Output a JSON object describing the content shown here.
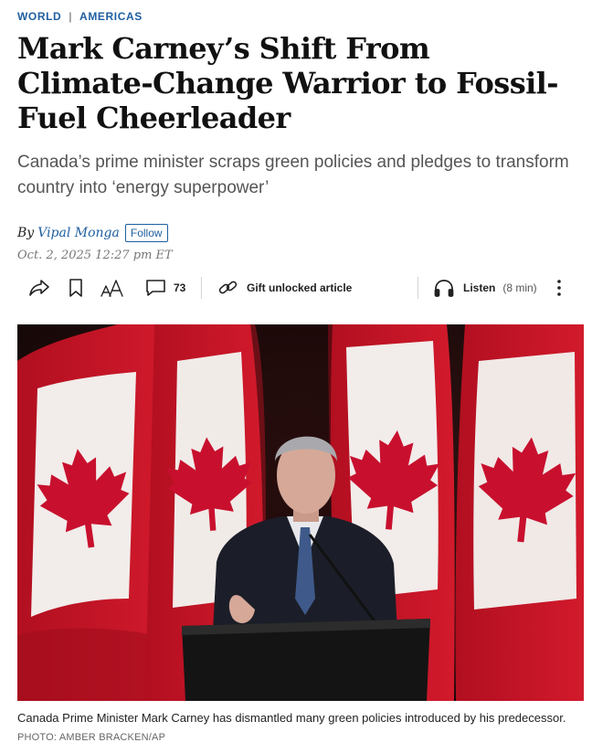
{
  "breadcrumb": {
    "section": "WORLD",
    "subsection": "AMERICAS"
  },
  "headline": "Mark Carney’s Shift From Climate-Change Warrior to Fossil-Fuel Cheerleader",
  "dek": "Canada’s prime minister scraps green policies and pledges to transform country into ‘energy superpower’",
  "byline": {
    "prefix": "By",
    "author": "Vipal Monga",
    "follow_label": "Follow"
  },
  "timestamp": "Oct. 2, 2025 12:27 pm ET",
  "toolbar": {
    "share_icon": "share-icon",
    "bookmark_icon": "bookmark-icon",
    "text_size_icon": "text-size-icon",
    "comments_icon": "comment-icon",
    "comment_count": "73",
    "gift_icon": "link-icon",
    "gift_label": "Gift unlocked article",
    "listen_icon": "headphones-icon",
    "listen_label": "Listen",
    "listen_duration": "(8 min)",
    "more_icon": "more-vertical-icon"
  },
  "photo": {
    "subject": "man speaking at a podium in front of Canadian flags"
  },
  "caption": {
    "text": "Canada Prime Minister Mark Carney has dismantled many green policies introduced by his predecessor.",
    "credit": "PHOTO: AMBER BRACKEN/AP"
  },
  "colors": {
    "link_blue": "#1f5fa0",
    "flag_red": "#c8102e",
    "dek_gray": "#555555"
  }
}
